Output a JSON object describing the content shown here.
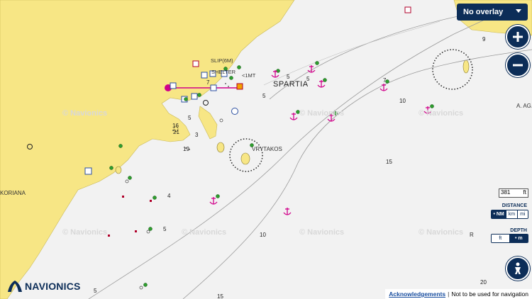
{
  "map": {
    "overlay_select": "No overlay",
    "scale": {
      "value": "381",
      "unit": "ft"
    },
    "distance": {
      "title": "DISTANCE",
      "options": [
        "NM",
        "km",
        "mi"
      ],
      "selected": "NM"
    },
    "depth": {
      "title": "DEPTH",
      "options": [
        "ft",
        "m"
      ],
      "selected": "m"
    },
    "logo": "NAVIONICS",
    "footer": {
      "link": "Acknowledgements",
      "separator": "|",
      "note": "Not to be used for navigation"
    },
    "place_labels": {
      "town": "SPARTIA",
      "islet": "VRYTAKOS",
      "left": "KORIANA",
      "right": "A. AG.",
      "slip": "SLIP(6M)",
      "shelter": "SHELTER",
      "onemt": "<1MT",
      "r": "R"
    },
    "watermark": "© Navionics",
    "depths": [
      "5",
      "5",
      "5",
      "7",
      "9",
      "10",
      "10",
      "15",
      "15",
      "20",
      "3",
      "4",
      "5",
      "5",
      "16",
      "21",
      "19",
      "5",
      "7"
    ],
    "colors": {
      "land": "#f7e685",
      "sea": "#f2f2f2",
      "navy": "#0c2d58",
      "anchor": "#d1008a",
      "buoy": "#2e9e2e",
      "route": "#d1008a"
    },
    "icons": [
      "plus-icon",
      "minus-icon",
      "person-icon",
      "anchor-icon",
      "buoy-icon",
      "marina-icon",
      "wreck-icon"
    ]
  }
}
